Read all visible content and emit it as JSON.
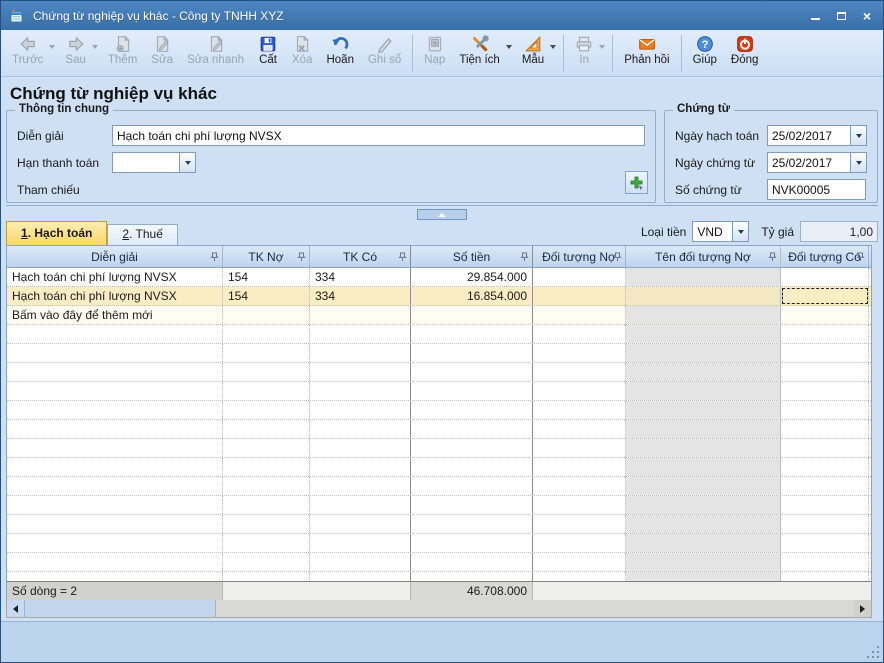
{
  "window": {
    "title": "Chứng từ nghiệp vụ khác - Công ty TNHH XYZ"
  },
  "toolbar": {
    "items": [
      {
        "label": "Trước",
        "icon": "back-arrow-icon",
        "enabled": false,
        "caret": true
      },
      {
        "label": "Sau",
        "icon": "forward-arrow-icon",
        "enabled": false,
        "caret": true
      },
      {
        "label": "Thêm",
        "icon": "add-document-icon",
        "enabled": false,
        "caret": false
      },
      {
        "label": "Sửa",
        "icon": "edit-document-icon",
        "enabled": false,
        "caret": false
      },
      {
        "label": "Sửa nhanh",
        "icon": "quick-edit-icon",
        "enabled": false,
        "caret": false
      },
      {
        "label": "Cất",
        "icon": "save-floppy-icon",
        "enabled": true,
        "caret": false
      },
      {
        "label": "Xóa",
        "icon": "delete-document-icon",
        "enabled": false,
        "caret": false
      },
      {
        "label": "Hoãn",
        "icon": "undo-icon",
        "enabled": true,
        "caret": false
      },
      {
        "label": "Ghi sổ",
        "icon": "pencil-icon",
        "enabled": false,
        "caret": false
      },
      {
        "label": "Nạp",
        "icon": "reload-document-icon",
        "enabled": false,
        "caret": false
      },
      {
        "label": "Tiện ích",
        "icon": "tools-icon",
        "enabled": true,
        "caret": true
      },
      {
        "label": "Mẫu",
        "icon": "ruler-triangle-icon",
        "enabled": true,
        "caret": true
      },
      {
        "label": "In",
        "icon": "printer-icon",
        "enabled": false,
        "caret": true
      },
      {
        "label": "Phản hồi",
        "icon": "envelope-icon",
        "enabled": true,
        "caret": false
      },
      {
        "label": "Giúp",
        "icon": "help-icon",
        "enabled": true,
        "caret": false
      },
      {
        "label": "Đóng",
        "icon": "power-icon",
        "enabled": true,
        "caret": false
      }
    ]
  },
  "page_title": "Chứng từ nghiệp vụ khác",
  "general_info": {
    "legend": "Thông tin chung",
    "dien_giai_label": "Diễn giải",
    "dien_giai_value": "Hạch toán chi phí lượng NVSX",
    "han_thanh_toan_label": "Hạn thanh toán",
    "han_thanh_toan_value": "",
    "tham_chieu_label": "Tham chiếu"
  },
  "document_info": {
    "legend": "Chứng từ",
    "ngay_hach_toan_label": "Ngày hạch toán",
    "ngay_hach_toan_value": "25/02/2017",
    "ngay_chung_tu_label": "Ngày chứng từ",
    "ngay_chung_tu_value": "25/02/2017",
    "so_chung_tu_label": "Số chứng từ",
    "so_chung_tu_value": "NVK00005"
  },
  "tabs": [
    {
      "number": "1",
      "rest": ". Hạch toán",
      "active": true
    },
    {
      "number": "2",
      "rest": ". Thuế",
      "active": false
    }
  ],
  "currency": {
    "loai_tien_label": "Loại tiền",
    "loai_tien_value": "VND",
    "ty_gia_label": "Tỷ giá",
    "ty_gia_value": "1,00"
  },
  "grid": {
    "columns": [
      {
        "label": "Diễn giải"
      },
      {
        "label": "TK Nợ"
      },
      {
        "label": "TK Có"
      },
      {
        "label": "Số tiền"
      },
      {
        "label": "Đối tượng Nợ"
      },
      {
        "label": "Tên đối tượng Nợ"
      },
      {
        "label": "Đối tượng Có"
      }
    ],
    "rows": [
      {
        "dien_giai": "Hạch toán chi phí lượng NVSX",
        "tk_no": "154",
        "tk_co": "334",
        "so_tien": "29.854.000",
        "doi_tuong_no": "",
        "ten_doi_tuong_no": "",
        "doi_tuong_co": ""
      },
      {
        "dien_giai": "Hạch toán chi phí lượng NVSX",
        "tk_no": "154",
        "tk_co": "334",
        "so_tien": "16.854.000",
        "doi_tuong_no": "",
        "ten_doi_tuong_no": "",
        "doi_tuong_co": "",
        "selected": true
      }
    ],
    "add_row_label": "Bấm vào đây để thêm mới",
    "footer": {
      "row_count": "Số dòng = 2",
      "so_tien_total": "46.708.000"
    }
  },
  "colors": {
    "titlebar_blue": "#3a6fa8",
    "panel_blue": "#cfe0f4",
    "selected_row_yellow": "#faecc3",
    "active_tab_gold": "#fbd667",
    "readonly_column_gray": "#e4e4e4"
  }
}
